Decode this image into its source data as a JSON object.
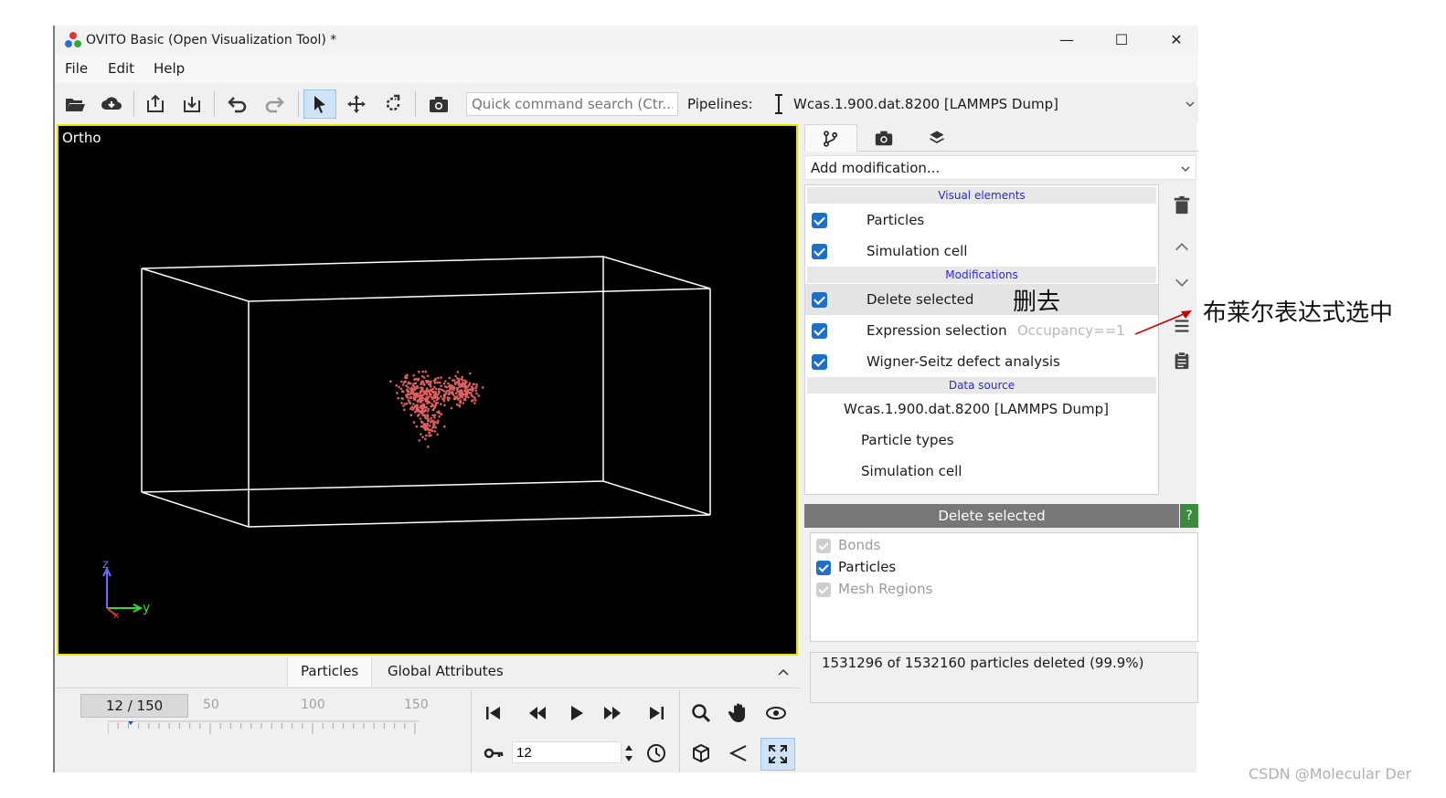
{
  "window": {
    "title": "OVITO Basic (Open Visualization Tool) *"
  },
  "menu": [
    "File",
    "Edit",
    "Help"
  ],
  "toolbar": {
    "search_placeholder": "Quick command search (Ctr...",
    "pipelines_label": "Pipelines:",
    "pipeline_name": "Wcas.1.900.dat.8200 [LAMMPS Dump]"
  },
  "viewport": {
    "label": "Ortho",
    "axis_z": "z",
    "axis_y": "y",
    "axis_x": "x",
    "particle_color": "#e06060",
    "border_color": "#e8e400"
  },
  "bottom_tabs": [
    "Particles",
    "Global Attributes"
  ],
  "animation": {
    "time": "12 / 150",
    "ticks": [
      "50",
      "100",
      "150"
    ],
    "frame": "12"
  },
  "right_panel": {
    "add_modification": "Add modification...",
    "sections": {
      "visual": "Visual elements",
      "modifications": "Modifications",
      "data_source": "Data source"
    },
    "visual_elements": [
      "Particles",
      "Simulation cell"
    ],
    "modifications": [
      {
        "label": "Delete selected",
        "status": ""
      },
      {
        "label": "Expression selection",
        "status": "Occupancy==1"
      },
      {
        "label": "Wigner-Seitz defect analysis",
        "status": ""
      }
    ],
    "data_source": [
      "Wcas.1.900.dat.8200 [LAMMPS Dump]",
      "Particle types",
      "Simulation cell"
    ],
    "editor_title": "Delete selected",
    "help": "?",
    "options": [
      {
        "label": "Bonds",
        "checked": true,
        "enabled": false
      },
      {
        "label": "Particles",
        "checked": true,
        "enabled": true
      },
      {
        "label": "Mesh Regions",
        "checked": true,
        "enabled": false
      }
    ],
    "status": "1531296 of 1532160 particles deleted (99.9%)"
  },
  "annotations": {
    "delete_note": "删去",
    "bool_note": "布莱尔表达式选中",
    "arrow_color": "#cc0000"
  },
  "watermark": "CSDN @Molecular Der"
}
